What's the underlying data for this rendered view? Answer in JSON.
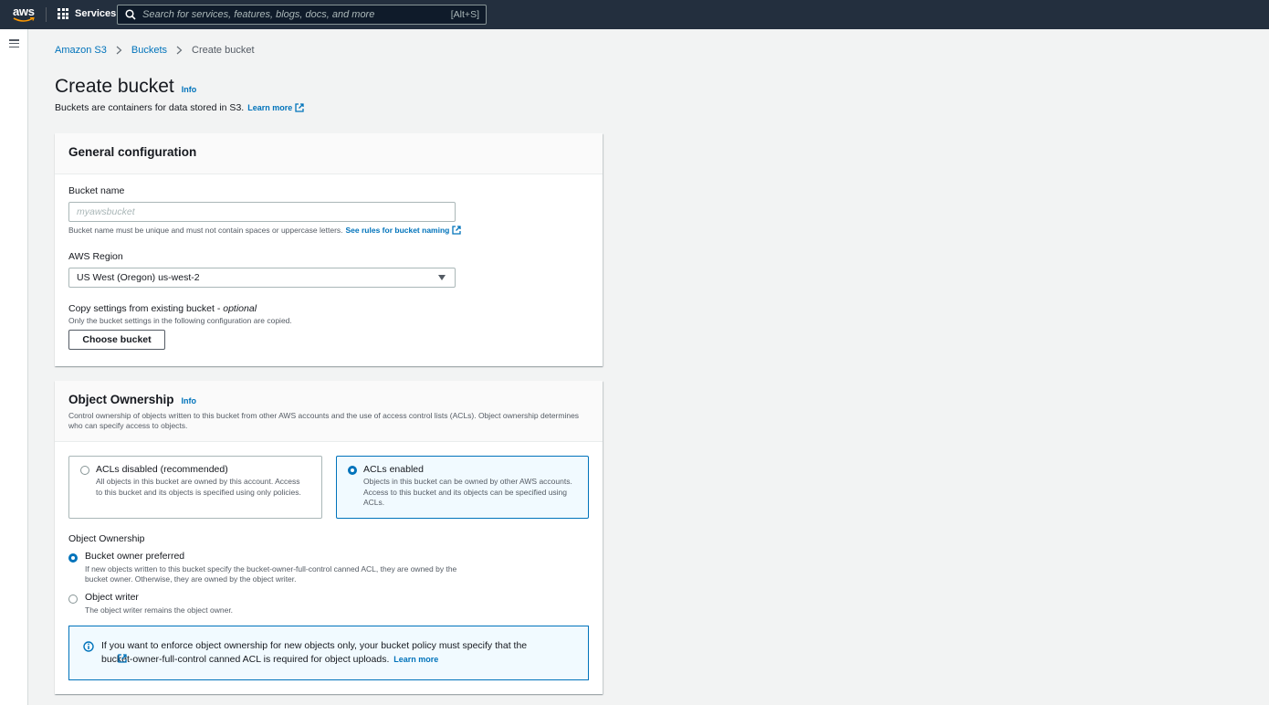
{
  "topnav": {
    "logo_text": "aws",
    "services_label": "Services",
    "search_placeholder": "Search for services, features, blogs, docs, and more",
    "search_shortcut": "[Alt+S]"
  },
  "breadcrumb": {
    "items": [
      "Amazon S3",
      "Buckets"
    ],
    "current": "Create bucket"
  },
  "header": {
    "title": "Create bucket",
    "info_label": "Info",
    "description": "Buckets are containers for data stored in S3.",
    "learn_more": "Learn more"
  },
  "general": {
    "title": "General configuration",
    "bucket_name_label": "Bucket name",
    "bucket_name_value": "",
    "bucket_name_placeholder": "myawsbucket",
    "bucket_name_hint": "Bucket name must be unique and must not contain spaces or uppercase letters.",
    "rules_link": "See rules for bucket naming",
    "region_label": "AWS Region",
    "region_value": "US West (Oregon) us-west-2",
    "copy_label": "Copy settings from existing bucket - ",
    "copy_optional": "optional",
    "copy_hint": "Only the bucket settings in the following configuration are copied.",
    "choose_bucket": "Choose bucket"
  },
  "ownership": {
    "title": "Object Ownership",
    "info_label": "Info",
    "description": "Control ownership of objects written to this bucket from other AWS accounts and the use of access control lists (ACLs). Object ownership determines who can specify access to objects.",
    "tiles": [
      {
        "title": "ACLs disabled (recommended)",
        "description": "All objects in this bucket are owned by this account. Access to this bucket and its objects is specified using only policies.",
        "selected": false
      },
      {
        "title": "ACLs enabled",
        "description": "Objects in this bucket can be owned by other AWS accounts. Access to this bucket and its objects can be specified using ACLs.",
        "selected": true
      }
    ],
    "sub_label": "Object Ownership",
    "options": [
      {
        "label": "Bucket owner preferred",
        "description": "If new objects written to this bucket specify the bucket-owner-full-control canned ACL, they are owned by the bucket owner. Otherwise, they are owned by the object writer.",
        "selected": true
      },
      {
        "label": "Object writer",
        "description": "The object writer remains the object owner.",
        "selected": false
      }
    ],
    "alert_text": "If you want to enforce object ownership for new objects only, your bucket policy must specify that the bucket-owner-full-control canned ACL is required for object uploads.",
    "alert_learn_more": "Learn more"
  },
  "colors": {
    "nav_bg": "#232f3e",
    "link": "#0073bb",
    "page_bg": "#f2f3f3",
    "smile": "#ff9900"
  }
}
